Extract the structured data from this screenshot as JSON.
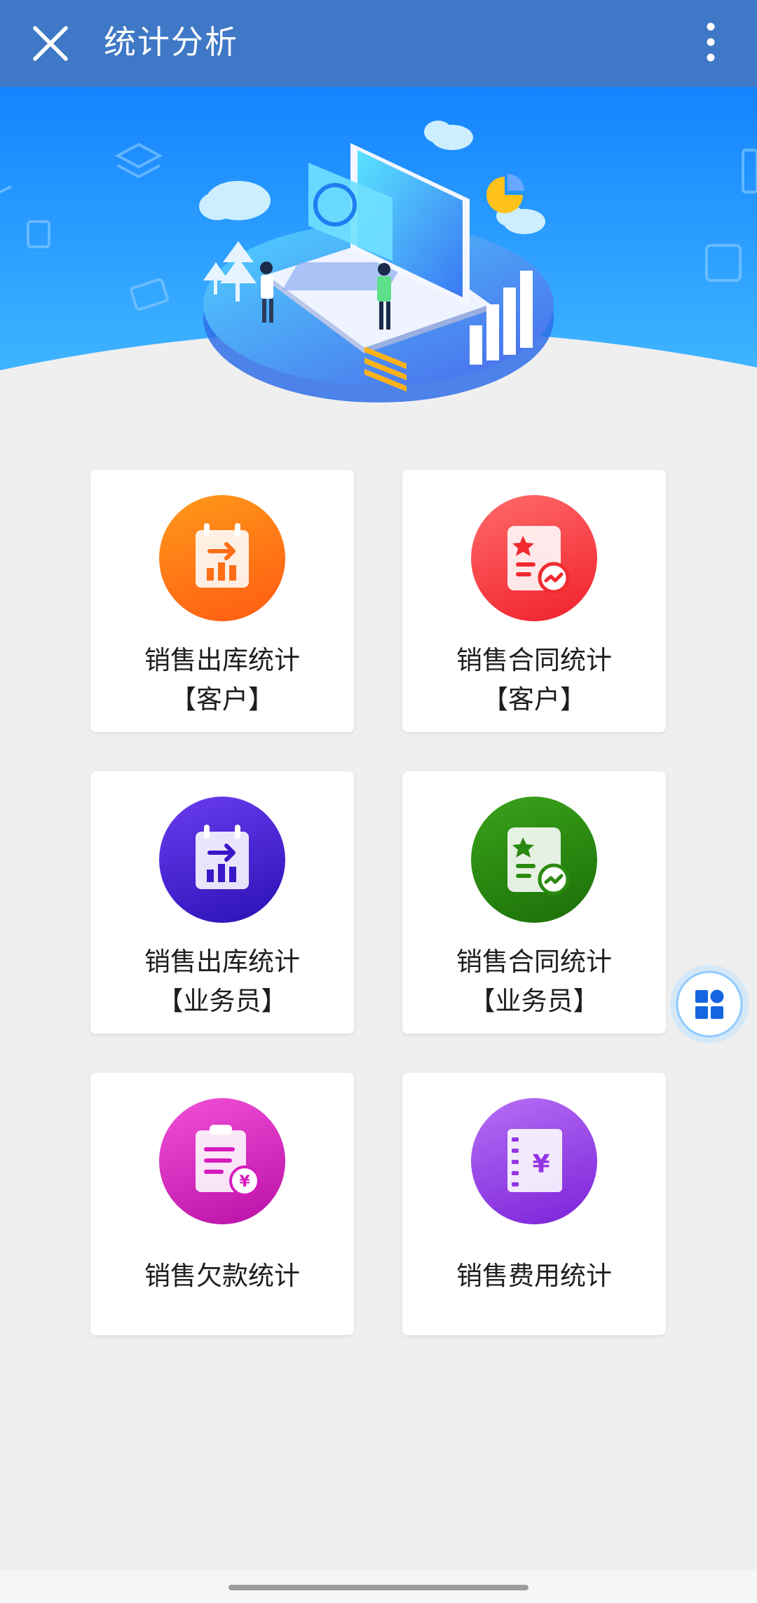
{
  "header": {
    "title": "统计分析",
    "close_icon": "close-icon",
    "more_icon": "more-vertical-icon",
    "background": "#3f78c6"
  },
  "banner": {
    "illustration": "data-analytics-laptop-illustration",
    "colors": [
      "#1e88ff",
      "#4fb0ff"
    ]
  },
  "cards": [
    {
      "label_line1": "销售出库统计",
      "label_line2": "【客户】",
      "icon": "calendar-transfer-chart-icon",
      "color": "#ff6d15"
    },
    {
      "label_line1": "销售合同统计",
      "label_line2": "【客户】",
      "icon": "contract-star-chart-icon",
      "color": "#f02a2f"
    },
    {
      "label_line1": "销售出库统计",
      "label_line2": "【业务员】",
      "icon": "calendar-transfer-chart-icon",
      "color": "#3a17c8"
    },
    {
      "label_line1": "销售合同统计",
      "label_line2": "【业务员】",
      "icon": "contract-star-chart-icon",
      "color": "#2a8a10"
    },
    {
      "label_line1": "销售欠款统计",
      "label_line2": "",
      "icon": "clipboard-yen-icon",
      "color": "#d51bbd"
    },
    {
      "label_line1": "销售费用统计",
      "label_line2": "",
      "icon": "notebook-yen-icon",
      "color": "#9435e4"
    }
  ],
  "fab": {
    "icon": "app-grid-icon",
    "color": "#1565e0"
  }
}
